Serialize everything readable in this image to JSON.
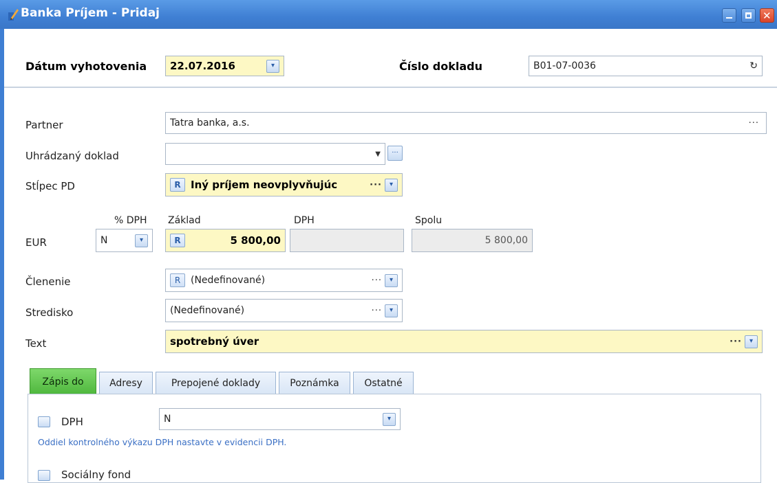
{
  "window": {
    "title": "Banka Príjem - Pridaj",
    "controls": [
      "minimize-icon",
      "maximize-icon",
      "close-icon"
    ],
    "accent_color": "#3f7fd3"
  },
  "header": {
    "date_label": "Dátum vyhotovenia",
    "date_value": "22.07.2016",
    "doc_number_label": "Číslo dokladu",
    "doc_number_value": "B01-07-0036"
  },
  "form": {
    "partner_label": "Partner",
    "partner_value": "Tatra banka, a.s.",
    "paid_doc_label": "Uhrádzaný doklad",
    "paid_doc_value": "",
    "column_label": "Stĺpec PD",
    "column_badge": "R",
    "column_value": "Iný príjem neovplyvňujúc",
    "currency_label": "EUR",
    "vat_pct_label": "% DPH",
    "vat_pct_value": "N",
    "base_label": "Základ",
    "base_badge": "R",
    "base_value": "5 800,00",
    "vat_label": "DPH",
    "vat_value": "",
    "total_label": "Spolu",
    "total_value": "5 800,00",
    "division_label": "Členenie",
    "division_badge": "R",
    "division_value": "(Nedefinované)",
    "center_label": "Stredisko",
    "center_value": "(Nedefinované)",
    "text_label": "Text",
    "text_value": "spotrebný úver",
    "highlight_color": "#fdf8c4"
  },
  "tabs": [
    {
      "label": "Zápis do",
      "active": true
    },
    {
      "label": "Adresy",
      "active": false
    },
    {
      "label": "Prepojené doklady",
      "active": false
    },
    {
      "label": "Poznámka",
      "active": false
    },
    {
      "label": "Ostatné",
      "active": false
    }
  ],
  "tab_content": {
    "vat_check_label": "DPH",
    "vat_select_value": "N",
    "vat_note": "Oddiel kontrolného výkazu DPH nastavte v evidencii DPH.",
    "social_fund_label": "Sociálny fond"
  }
}
